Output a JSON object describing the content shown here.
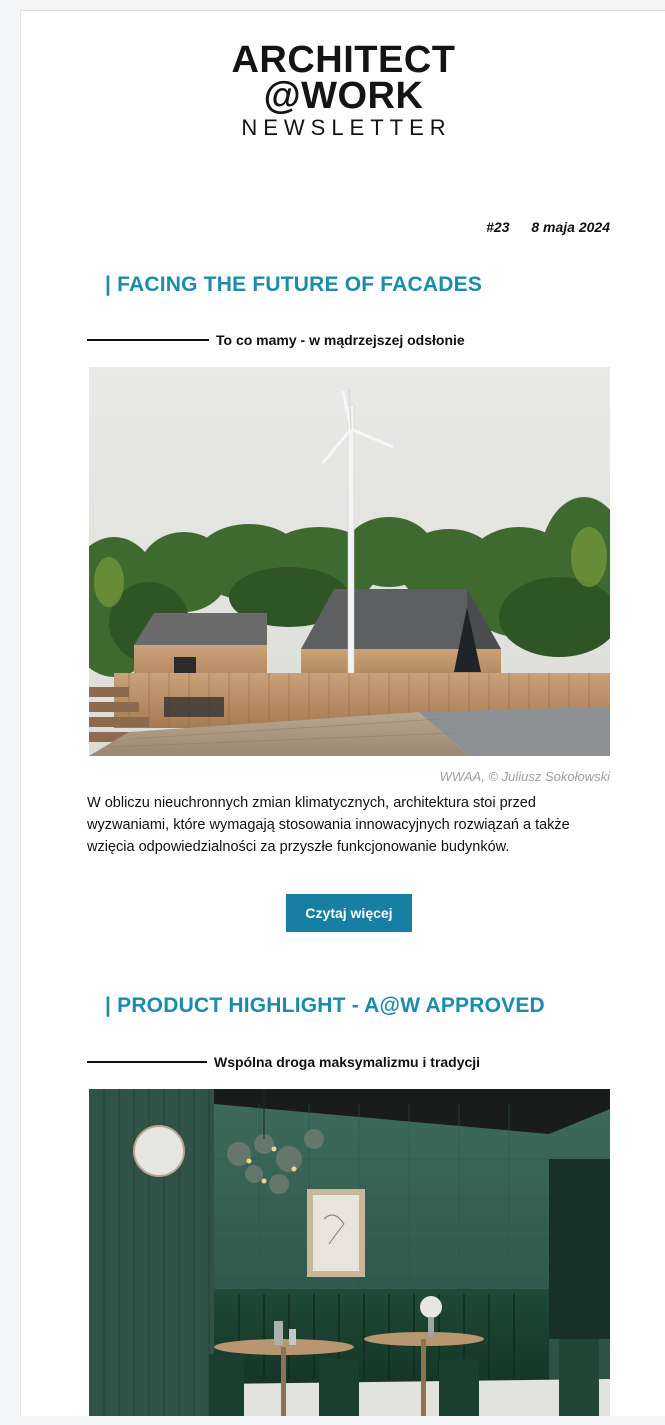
{
  "header": {
    "logo_line1": "ARCHITECT",
    "logo_line2": "@WORK",
    "logo_line3": "NEWSLETTER",
    "issue_number": "#23",
    "date": "8 maja 2024"
  },
  "article1": {
    "section_title": "| FACING THE FUTURE OF FACADES",
    "subtitle": "To co mamy - w mądrzejszej odsłonie",
    "image_caption": "WWAA, © Juliusz Sokołowski",
    "body": "W obliczu nieuchronnych zmian klimatycznych, architektura stoi przed wyzwaniami, które wymagają stosowania innowacyjnych rozwiązań a także wzięcia odpowiedzialności za przyszłe funkcjonowanie budynków.",
    "button_label": "Czytaj więcej"
  },
  "article2": {
    "section_title": "| PRODUCT HIGHLIGHT - A@W APPROVED",
    "subtitle": "Wspólna droga maksymalizmu i tradycji"
  },
  "colors": {
    "accent": "#1b8cad",
    "button": "#177fa3",
    "caption": "#9aa0a6"
  }
}
